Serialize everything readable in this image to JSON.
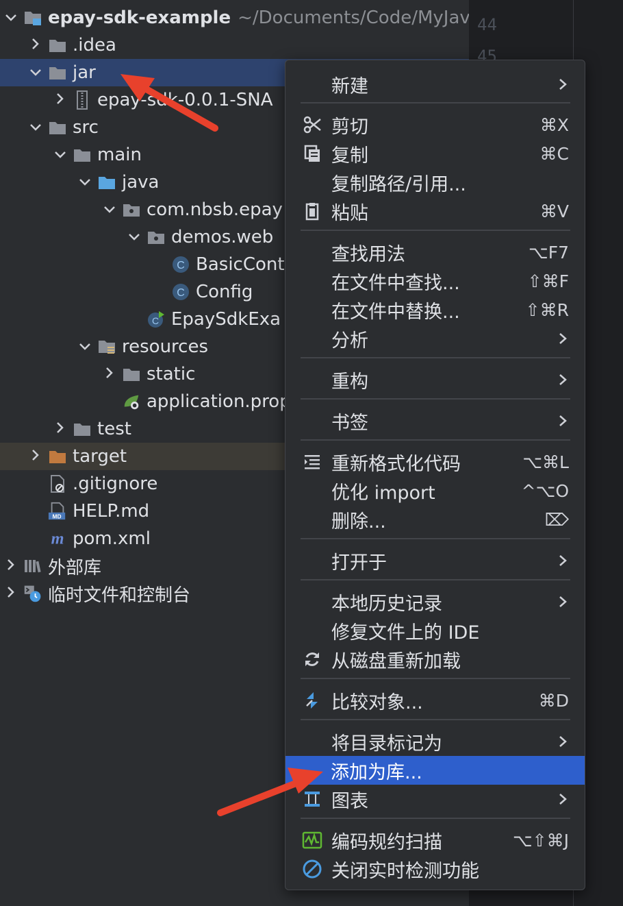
{
  "tree": {
    "rows": [
      {
        "label": "epay-sdk-example",
        "path": "~/Documents/Code/MyJav",
        "chev": "v",
        "icon": "project-folder-icon"
      },
      {
        "label": ".idea",
        "chev": ">",
        "icon": "folder-icon"
      },
      {
        "label": "jar",
        "chev": "v",
        "icon": "folder-icon"
      },
      {
        "label": "epay-sdk-0.0.1-SNA",
        "chev": ">",
        "icon": "jar-archive-icon"
      },
      {
        "label": "src",
        "chev": "v",
        "icon": "folder-icon"
      },
      {
        "label": "main",
        "chev": "v",
        "icon": "folder-icon"
      },
      {
        "label": "java",
        "chev": "v",
        "icon": "source-folder-icon"
      },
      {
        "label": "com.nbsb.epay",
        "chev": "v",
        "icon": "package-icon"
      },
      {
        "label": "demos.web",
        "chev": "v",
        "icon": "package-icon"
      },
      {
        "label": "BasicCont",
        "chev": "",
        "icon": "class-icon"
      },
      {
        "label": "Config",
        "chev": "",
        "icon": "class-icon"
      },
      {
        "label": "EpaySdkExa",
        "chev": "",
        "icon": "spring-boot-class-icon"
      },
      {
        "label": "resources",
        "chev": "v",
        "icon": "resources-folder-icon"
      },
      {
        "label": "static",
        "chev": ">",
        "icon": "folder-icon"
      },
      {
        "label": "application.prop",
        "chev": "",
        "icon": "spring-properties-icon"
      },
      {
        "label": "test",
        "chev": ">",
        "icon": "folder-icon"
      },
      {
        "label": "target",
        "chev": ">",
        "icon": "excluded-folder-icon"
      },
      {
        "label": ".gitignore",
        "chev": "",
        "icon": "gitignore-file-icon"
      },
      {
        "label": "HELP.md",
        "chev": "",
        "icon": "markdown-file-icon"
      },
      {
        "label": "pom.xml",
        "chev": "",
        "icon": "maven-file-icon"
      },
      {
        "label": "外部库",
        "chev": ">",
        "icon": "external-libraries-icon"
      },
      {
        "label": "临时文件和控制台",
        "chev": ">",
        "icon": "scratches-icon"
      }
    ]
  },
  "gutter": {
    "lines": [
      "44",
      "45"
    ]
  },
  "menu": {
    "items": [
      {
        "label": "新建",
        "shortcut": "",
        "submenu": true,
        "icon": ""
      },
      {
        "label": "剪切",
        "shortcut": "⌘X",
        "submenu": false,
        "icon": "scissors-icon"
      },
      {
        "label": "复制",
        "shortcut": "⌘C",
        "submenu": false,
        "icon": "copy-icon"
      },
      {
        "label": "复制路径/引用...",
        "shortcut": "",
        "submenu": false,
        "icon": ""
      },
      {
        "label": "粘贴",
        "shortcut": "⌘V",
        "submenu": false,
        "icon": "paste-icon"
      },
      {
        "label": "查找用法",
        "shortcut": "⌥F7",
        "submenu": false,
        "icon": ""
      },
      {
        "label": "在文件中查找...",
        "shortcut": "⇧⌘F",
        "submenu": false,
        "icon": ""
      },
      {
        "label": "在文件中替换...",
        "shortcut": "⇧⌘R",
        "submenu": false,
        "icon": ""
      },
      {
        "label": "分析",
        "shortcut": "",
        "submenu": true,
        "icon": ""
      },
      {
        "label": "重构",
        "shortcut": "",
        "submenu": true,
        "icon": ""
      },
      {
        "label": "书签",
        "shortcut": "",
        "submenu": true,
        "icon": ""
      },
      {
        "label": "重新格式化代码",
        "shortcut": "⌥⌘L",
        "submenu": false,
        "icon": "reformat-icon"
      },
      {
        "label": "优化 import",
        "shortcut": "^⌥O",
        "submenu": false,
        "icon": ""
      },
      {
        "label": "删除...",
        "shortcut": "⌦",
        "submenu": false,
        "icon": ""
      },
      {
        "label": "打开于",
        "shortcut": "",
        "submenu": true,
        "icon": ""
      },
      {
        "label": "本地历史记录",
        "shortcut": "",
        "submenu": true,
        "icon": ""
      },
      {
        "label": "修复文件上的 IDE",
        "shortcut": "",
        "submenu": false,
        "icon": ""
      },
      {
        "label": "从磁盘重新加载",
        "shortcut": "",
        "submenu": false,
        "icon": "reload-icon"
      },
      {
        "label": "比较对象...",
        "shortcut": "⌘D",
        "submenu": false,
        "icon": "compare-icon"
      },
      {
        "label": "将目录标记为",
        "shortcut": "",
        "submenu": true,
        "icon": ""
      },
      {
        "label": "添加为库...",
        "shortcut": "",
        "submenu": false,
        "icon": "",
        "highlighted": true
      },
      {
        "label": "图表",
        "shortcut": "",
        "submenu": true,
        "icon": "diagram-icon"
      },
      {
        "label": "编码规约扫描",
        "shortcut": "⌥⇧⌘J",
        "submenu": false,
        "icon": "code-scan-icon"
      },
      {
        "label": "关闭实时检测功能",
        "shortcut": "",
        "submenu": false,
        "icon": "disable-icon"
      }
    ]
  },
  "colors": {
    "selection": "#2e436e",
    "highlight": "#2e5fcc",
    "annotation": "#e8412c",
    "folder": "#8b8f97",
    "excluded": "#c17a3f",
    "source": "#5aa6e0"
  }
}
